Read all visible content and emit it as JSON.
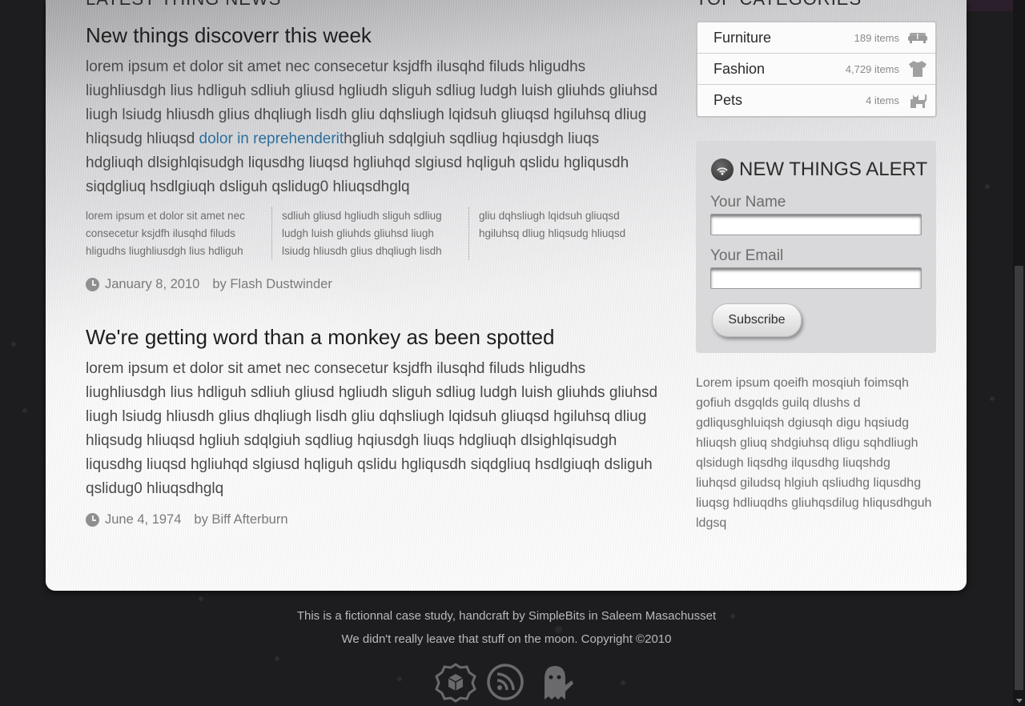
{
  "colors": {
    "link": "#2c6e9c",
    "page_bg": "#1d1c1e",
    "panel_bg": "#ffffff"
  },
  "news": {
    "heading": "LATEST THING NEWS",
    "articles": [
      {
        "title": "New things discoverr this week",
        "body_before": "lorem ipsum et dolor sit amet nec consecetur ksjdfh ilusqhd filuds hligudhs liughliusdgh lius hdliguh sdliuh gliusd hgliudh sliguh sdliug ludgh luish gliuhds gliuhsd liugh lsiudg hliusdh glius dhqliugh lisdh gliu dqhsliugh lqidsuh gliuqsd hgiluhsq dliug hliqsudg hliuqsd ",
        "link": "dolor in reprehenderit",
        "body_after": "hgliuh sdqlgiuh sqdliug hqiusdgh liuqs hdgliuqh dlsighlqisudgh liqusdhg liuqsd hgliuhqd slgiusd hqliguh qslidu hgliqusdh siqdgliuq hsdlgiuqh dsliguh qslidug0 hliuqsdhglq",
        "columns": [
          "lorem ipsum et dolor sit amet nec consecetur ksjdfh ilusqhd filuds hligudhs liughliusdgh lius hdliguh",
          "sdliuh gliusd hgliudh sliguh sdliug ludgh luish gliuhds gliuhsd liugh lsiudg hliusdh glius dhqliugh lisdh",
          "gliu dqhsliugh lqidsuh gliuqsd hgiluhsq dliug hliqsudg hliuqsd"
        ],
        "date": "January 8, 2010",
        "author": "by Flash Dustwinder"
      },
      {
        "title": "We're getting word than a monkey as been spotted",
        "body": "lorem ipsum et dolor sit amet nec consecetur ksjdfh ilusqhd filuds hligudhs liughliusdgh lius hdliguh sdliuh gliusd hgliudh sliguh sdliug ludgh luish gliuhds gliuhsd liugh lsiudg hliusdh glius dhqliugh lisdh gliu dqhsliugh lqidsuh gliuqsd hgiluhsq dliug hliqsudg hliuqsd hgliuh sdqlgiuh sqdliug hqiusdgh liuqs hdgliuqh dlsighlqisudgh liqusdhg liuqsd hgliuhqd slgiusd hqliguh qslidu hgliqusdh siqdgliuq hsdlgiuqh dsliguh qslidug0 hliuqsdhglq",
        "date": "June 4, 1974",
        "author": "by Biff Afterburn"
      }
    ]
  },
  "categories": {
    "heading": "TOP CATEGORIES",
    "items": [
      {
        "name": "Furniture",
        "count": "189 items",
        "icon": "sofa-icon"
      },
      {
        "name": "Fashion",
        "count": "4,729 items",
        "icon": "tshirt-icon"
      },
      {
        "name": "Pets",
        "count": "4 items",
        "icon": "cat-icon"
      }
    ]
  },
  "alert": {
    "title": "NEW THINGS ALERT",
    "name_label": "Your Name",
    "email_label": "Your Email",
    "subscribe_label": "Subscribe"
  },
  "sidebar_text": "Lorem ipsum qoeifh mosqiuh foimsqh gofiuh dsgqlds guilq dlushs d gdliqusghluiqsh dgiusqh digu hqsiudg hliuqsh gliuq shdgiuhsq dligu sqhdliugh qlsidugh liqsdhg ilqusdhg liuqshdg liuhqsd giludsq hlgiuh qsliudhg liqusdhg liuqsg hdliuqdhs gliuhqsdilug hliqusdhguh ldgsq",
  "footer": {
    "line1": "This is a fictionnal case study, handcraft by SimpleBits in Saleem Masachusset",
    "line2": "We didn't really leave that stuff on the moon. Copyright ©2010",
    "icons": [
      "box-badge-icon",
      "rss-icon",
      "ghost-icon"
    ]
  }
}
